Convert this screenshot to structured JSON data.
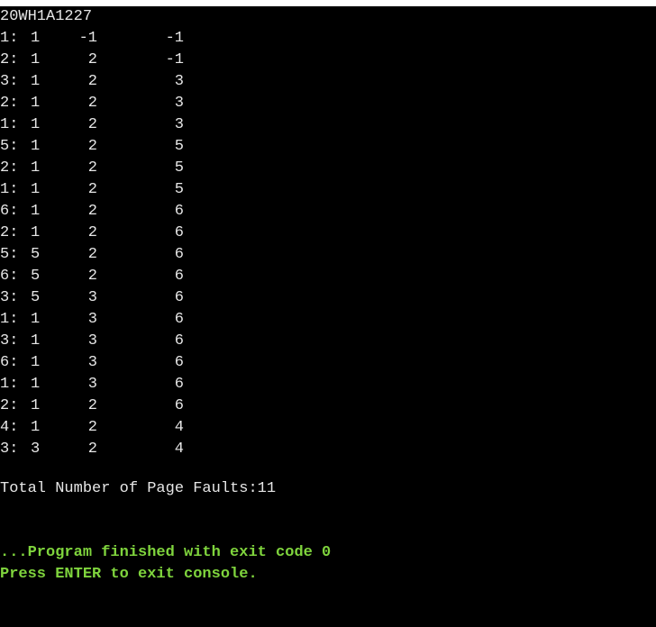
{
  "console": {
    "header": "20WH1A1227",
    "rows": [
      {
        "page": "1:",
        "f1": "1",
        "f2": "-1",
        "f3": "-1"
      },
      {
        "page": "2:",
        "f1": "1",
        "f2": "2",
        "f3": "-1"
      },
      {
        "page": "3:",
        "f1": "1",
        "f2": "2",
        "f3": "3"
      },
      {
        "page": "2:",
        "f1": "1",
        "f2": "2",
        "f3": "3"
      },
      {
        "page": "1:",
        "f1": "1",
        "f2": "2",
        "f3": "3"
      },
      {
        "page": "5:",
        "f1": "1",
        "f2": "2",
        "f3": "5"
      },
      {
        "page": "2:",
        "f1": "1",
        "f2": "2",
        "f3": "5"
      },
      {
        "page": "1:",
        "f1": "1",
        "f2": "2",
        "f3": "5"
      },
      {
        "page": "6:",
        "f1": "1",
        "f2": "2",
        "f3": "6"
      },
      {
        "page": "2:",
        "f1": "1",
        "f2": "2",
        "f3": "6"
      },
      {
        "page": "5:",
        "f1": "5",
        "f2": "2",
        "f3": "6"
      },
      {
        "page": "6:",
        "f1": "5",
        "f2": "2",
        "f3": "6"
      },
      {
        "page": "3:",
        "f1": "5",
        "f2": "3",
        "f3": "6"
      },
      {
        "page": "1:",
        "f1": "1",
        "f2": "3",
        "f3": "6"
      },
      {
        "page": "3:",
        "f1": "1",
        "f2": "3",
        "f3": "6"
      },
      {
        "page": "6:",
        "f1": "1",
        "f2": "3",
        "f3": "6"
      },
      {
        "page": "1:",
        "f1": "1",
        "f2": "3",
        "f3": "6"
      },
      {
        "page": "2:",
        "f1": "1",
        "f2": "2",
        "f3": "6"
      },
      {
        "page": "4:",
        "f1": "1",
        "f2": "2",
        "f3": "4"
      },
      {
        "page": "3:",
        "f1": "3",
        "f2": "2",
        "f3": "4"
      }
    ],
    "summary": "Total Number of Page Faults:11",
    "finished_msg": "...Program finished with exit code 0",
    "exit_prompt": "Press ENTER to exit console.",
    "colors": {
      "background": "#000000",
      "text": "#e6e6e6",
      "status_green": "#7fd43d"
    }
  }
}
